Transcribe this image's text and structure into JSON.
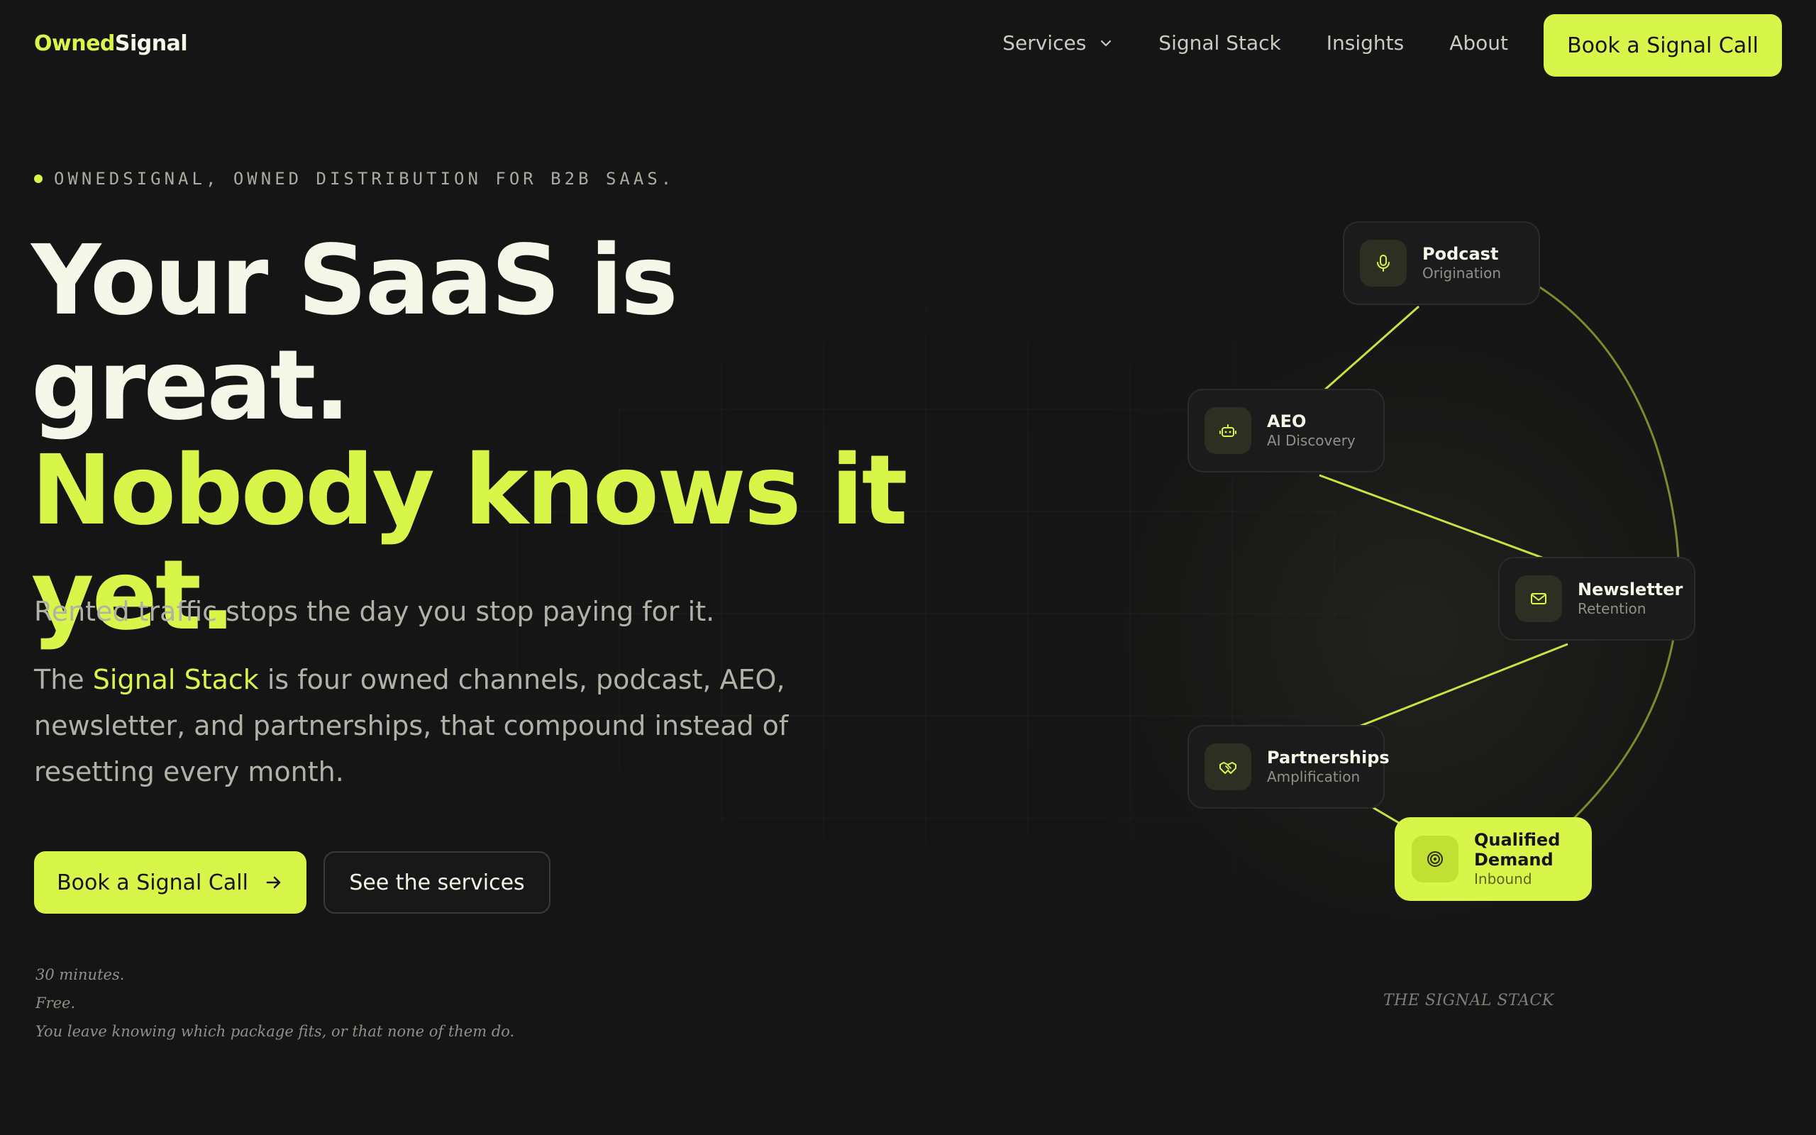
{
  "brand": {
    "logo_part1": "Owned",
    "logo_part2": "Signal",
    "accent_color": "#d8f64a",
    "background_color": "#151515"
  },
  "nav": {
    "items": [
      {
        "label": "Services",
        "has_dropdown": true
      },
      {
        "label": "Signal Stack"
      },
      {
        "label": "Insights"
      },
      {
        "label": "About"
      }
    ],
    "cta_label": "Book a Signal Call"
  },
  "hero": {
    "eyebrow": "OWNEDSIGNAL, OWNED DISTRIBUTION FOR B2B SAAS.",
    "headline_line1": "Your SaaS is great.",
    "headline_line2": "Nobody knows it yet.",
    "subhead": "Rented traffic stops the day you stop paying for it.",
    "body_prefix": "The ",
    "body_highlight": "Signal Stack",
    "body_suffix": " is four owned channels, podcast, AEO, newsletter, and partnerships, that compound instead of resetting every month.",
    "primary_cta": "Book a Signal Call",
    "secondary_cta": "See the services",
    "note_lines": [
      "30 minutes.",
      "Free.",
      "You leave knowing which package fits, or that none of them do."
    ]
  },
  "signal_stack": {
    "caption": "THE SIGNAL STACK",
    "nodes": [
      {
        "title": "Podcast",
        "subtitle": "Origination",
        "icon": "mic-icon"
      },
      {
        "title": "AEO",
        "subtitle": "AI Discovery",
        "icon": "robot-icon"
      },
      {
        "title": "Newsletter",
        "subtitle": "Retention",
        "icon": "mail-icon"
      },
      {
        "title": "Partnerships",
        "subtitle": "Amplification",
        "icon": "handshake-icon"
      },
      {
        "title": "Qualified Demand",
        "subtitle": "Inbound",
        "icon": "target-icon",
        "active": true
      }
    ]
  }
}
